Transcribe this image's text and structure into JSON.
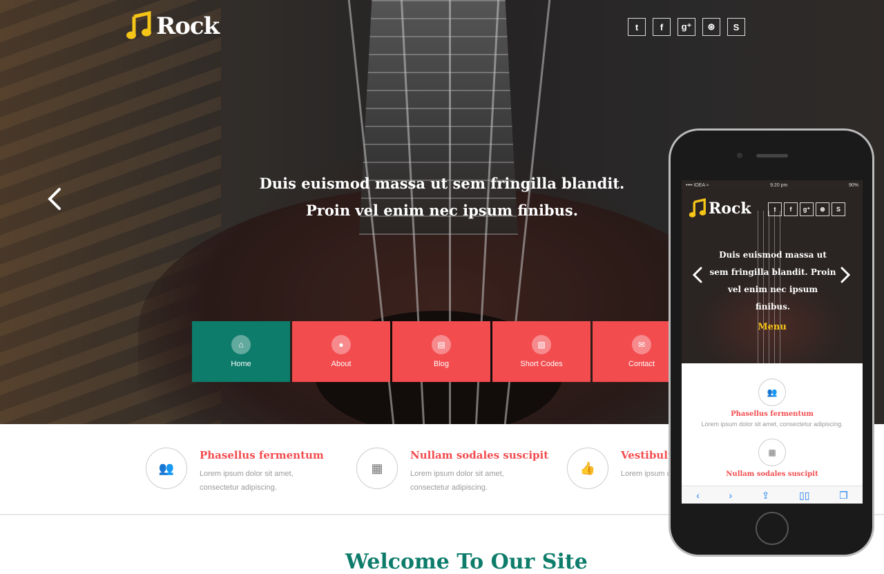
{
  "header": {
    "logo_text": "Rock",
    "social": [
      "twitter-icon",
      "facebook-icon",
      "google-plus-icon",
      "dribbble-icon",
      "skype-icon"
    ],
    "social_glyphs": [
      "t",
      "f",
      "g⁺",
      "⊛",
      "S"
    ]
  },
  "hero": {
    "caption": "Duis euismod massa ut sem fringilla blandit. Proin vel enim nec ipsum finibus."
  },
  "nav": {
    "items": [
      {
        "label": "Home",
        "icon": "home-icon",
        "glyph": "⌂",
        "active": true
      },
      {
        "label": "About",
        "icon": "user-icon",
        "glyph": "●",
        "active": false
      },
      {
        "label": "Blog",
        "icon": "blog-icon",
        "glyph": "▤",
        "active": false
      },
      {
        "label": "Short Codes",
        "icon": "image-icon",
        "glyph": "▨",
        "active": false
      },
      {
        "label": "Contact",
        "icon": "mail-icon",
        "glyph": "✉",
        "active": false
      }
    ]
  },
  "features": [
    {
      "title": "Phasellus fermentum",
      "text": "Lorem ipsum dolor sit amet, consectetur adipiscing.",
      "icon": "users-icon",
      "glyph": "👥"
    },
    {
      "title": "Nullam sodales suscipit",
      "text": "Lorem ipsum dolor sit amet, consectetur adipiscing.",
      "icon": "film-icon",
      "glyph": "▦"
    },
    {
      "title": "Vestibulum",
      "text": "Lorem ipsum dol adipiscing.",
      "icon": "thumbs-up-icon",
      "glyph": "👍"
    }
  ],
  "welcome": {
    "title": "Welcome To Our Site"
  },
  "phone": {
    "status_carrier": "•••• IDEA ≈",
    "status_time": "9:20 pm",
    "status_battery": "90%",
    "logo_text": "Rock",
    "caption": "Duis euismod massa ut sem fringilla blandit. Proin vel enim nec ipsum finibus.",
    "menu_label": "Menu",
    "feature1_title": "Phasellus fermentum",
    "feature1_text": "Lorem ipsum dolor sit amet, consectetur adipiscing.",
    "feature2_title": "Nullam sodales suscipit"
  },
  "colors": {
    "accent_red": "#f24c4f",
    "accent_teal": "#0e7c6b",
    "logo_yellow": "#f5c518"
  }
}
